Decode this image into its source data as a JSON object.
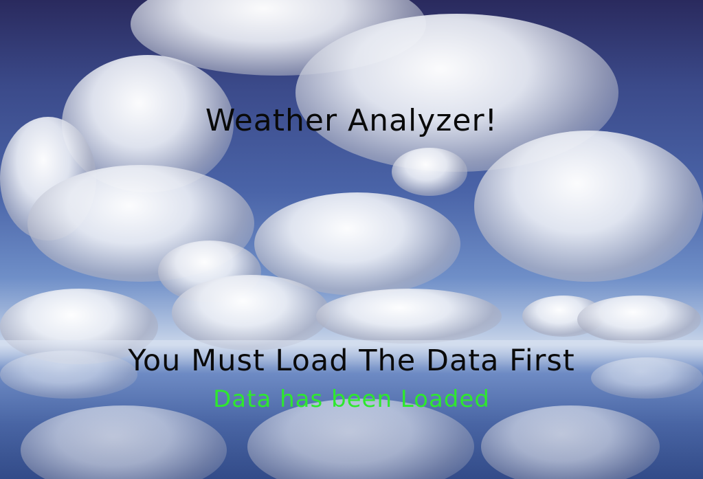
{
  "app": {
    "title": "Weather Analyzer!",
    "warning_message": "You Must Load The Data First",
    "status_message": "Data has been Loaded"
  },
  "background": {
    "description_icon": "cloudy-sky-background"
  },
  "colors": {
    "title_text": "#0a0a0a",
    "warning_text": "#0a0a0a",
    "status_text": "#2ee82e"
  }
}
